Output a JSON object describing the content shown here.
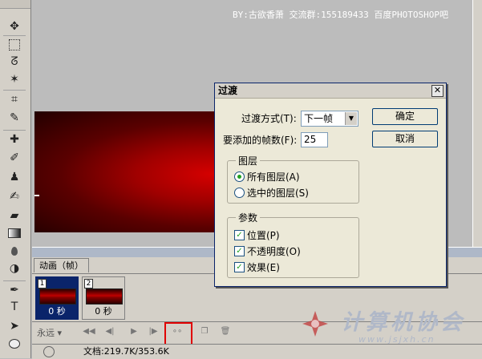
{
  "watermark_top": "BY:古欲香萧 交流群:155189433   百度PHOTOSHOP吧",
  "tools": [
    "move-tool",
    "marquee-tool",
    "lasso-tool",
    "magic-wand-tool",
    "crop-tool",
    "eyedropper-tool",
    "healing-brush-tool",
    "brush-tool",
    "clone-stamp-tool",
    "history-brush-tool",
    "eraser-tool",
    "gradient-tool",
    "blur-tool",
    "dodge-tool",
    "pen-tool",
    "type-tool",
    "path-selection-tool",
    "shape-tool"
  ],
  "animation": {
    "tab_label": "动画（帧）",
    "frames": [
      {
        "number": "1",
        "delay": "0 秒",
        "selected": true
      },
      {
        "number": "2",
        "delay": "0 秒",
        "selected": false
      }
    ],
    "loop": "永远"
  },
  "status": {
    "doc": "文档:219.7K/353.6K"
  },
  "dialog": {
    "title": "过渡",
    "method_label": "过渡方式(T):",
    "method_value": "下一帧",
    "frames_label": "要添加的帧数(F):",
    "frames_value": "25",
    "ok_label": "确定",
    "cancel_label": "取消",
    "layers_group": "图层",
    "all_layers": "所有图层(A)",
    "selected_layers": "选中的图层(S)",
    "params_group": "参数",
    "position": "位置(P)",
    "opacity": "不透明度(O)",
    "effects": "效果(E)"
  },
  "watermark_bottom": {
    "cn": "计算机协会",
    "url": "www.jsjxh.cn"
  },
  "colors": {
    "canvas_red": "#d50000",
    "highlight": "#e00000",
    "dialog_bg": "#ece9d8"
  }
}
